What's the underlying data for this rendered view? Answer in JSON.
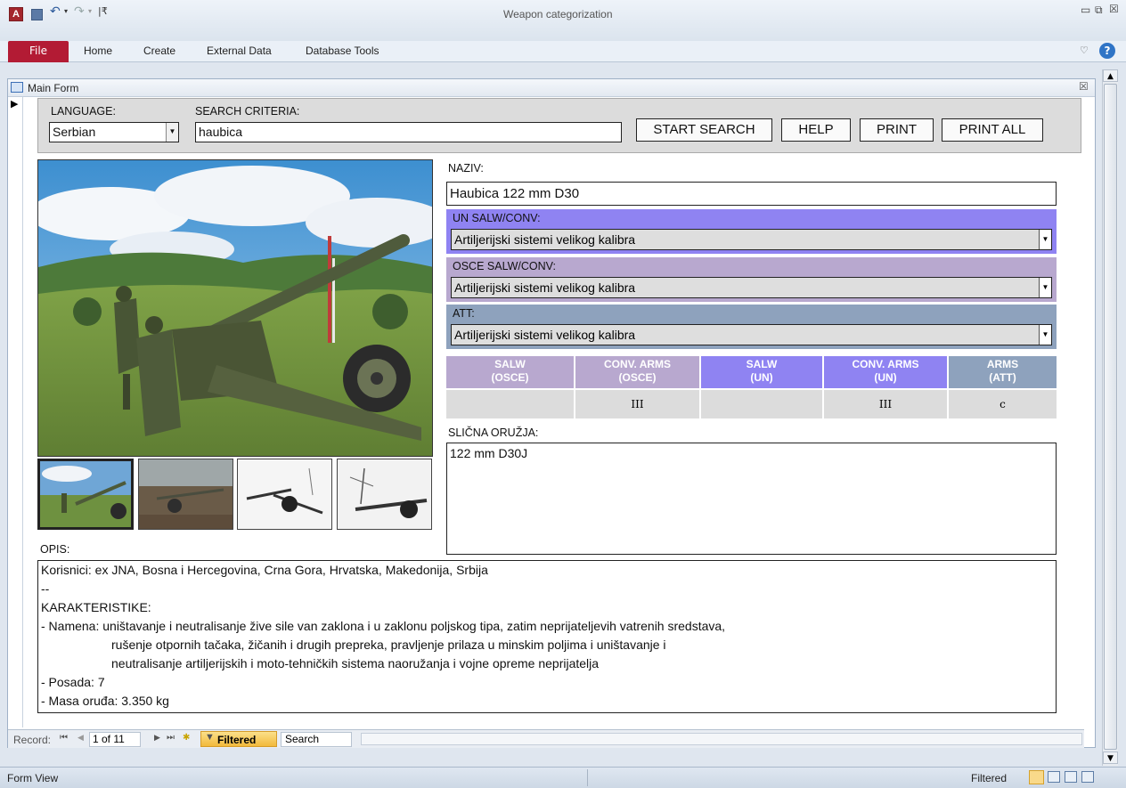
{
  "window": {
    "title": "Weapon categorization"
  },
  "ribbon": {
    "tabs": [
      "File",
      "Home",
      "Create",
      "External Data",
      "Database Tools"
    ]
  },
  "form": {
    "title": "Main Form"
  },
  "search": {
    "language_label": "LANGUAGE:",
    "language_value": "Serbian",
    "criteria_label": "SEARCH CRITERIA:",
    "criteria_value": "haubica",
    "buttons": {
      "start": "START SEARCH",
      "help": "HELP",
      "print": "PRINT",
      "print_all": "PRINT ALL"
    }
  },
  "details": {
    "name_label": "NAZIV:",
    "name_value": "Haubica 122 mm D30",
    "un_label": "UN SALW/CONV:",
    "un_value": "Artiljerijski sistemi velikog kalibra",
    "osce_label": "OSCE SALW/CONV:",
    "osce_value": "Artiljerijski sistemi velikog kalibra",
    "att_label": "ATT:",
    "att_value": "Artiljerijski sistemi velikog kalibra"
  },
  "classification": {
    "headers": [
      {
        "line1": "SALW",
        "line2": "(OSCE)"
      },
      {
        "line1": "CONV. ARMS",
        "line2": "(OSCE)"
      },
      {
        "line1": "SALW",
        "line2": "(UN)"
      },
      {
        "line1": "CONV. ARMS",
        "line2": "(UN)"
      },
      {
        "line1": "ARMS",
        "line2": "(ATT)"
      }
    ],
    "values": [
      "",
      "III",
      "",
      "III",
      "c"
    ],
    "colors": {
      "osce": "#b8a8cf",
      "un": "#8f83f2",
      "att": "#8ea2bd"
    }
  },
  "similar": {
    "label": "SLIČNA ORUŽJA:",
    "value": "122 mm D30J"
  },
  "opis": {
    "label": "OPIS:",
    "lines": [
      "Korisnici: ex JNA, Bosna i Hercegovina, Crna Gora, Hrvatska, Makedonija, Srbija",
      "--",
      "KARAKTERISTIKE:",
      "- Namena: uništavanje i neutralisanje žive sile van zaklona i u zaklonu poljskog tipa, zatim neprijateljevih vatrenih sredstava,",
      "rušenje otpornih tačaka, žičanih i drugih prepreka, pravljenje prilaza u minskim poljima i uništavanje i",
      "neutralisanje artiljerijskih i moto-tehničkih sistema naoružanja i vojne opreme neprijatelja",
      "- Posada:  7",
      "- Masa oruđa:  3.350 kg"
    ]
  },
  "navigation": {
    "record_label": "Record:",
    "current": "1 of 11",
    "filter": "Filtered",
    "search": "Search"
  },
  "status": {
    "left": "Form View",
    "right": "Filtered"
  }
}
